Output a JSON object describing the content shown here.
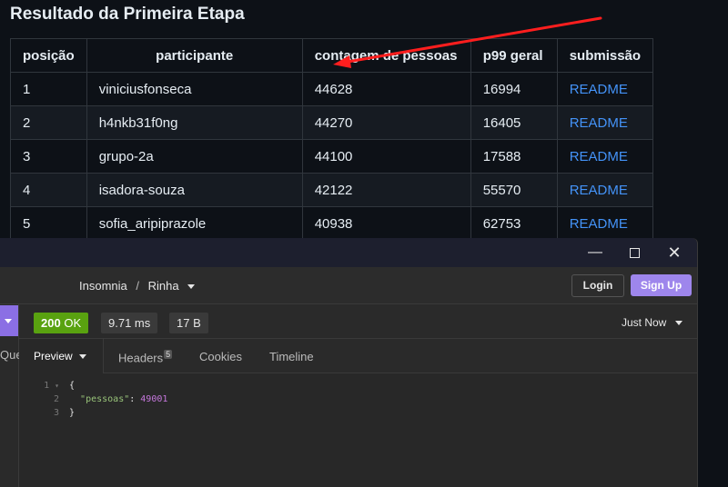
{
  "page": {
    "title": "Resultado da Primeira Etapa"
  },
  "results_table": {
    "headers": [
      "posição",
      "participante",
      "contagem de pessoas",
      "p99 geral",
      "submissão"
    ],
    "rows": [
      {
        "pos": "1",
        "participant": "viniciusfonseca",
        "count": "44628",
        "p99": "16994",
        "submission": "README"
      },
      {
        "pos": "2",
        "participant": "h4nkb31f0ng",
        "count": "44270",
        "p99": "16405",
        "submission": "README"
      },
      {
        "pos": "3",
        "participant": "grupo-2a",
        "count": "44100",
        "p99": "17588",
        "submission": "README"
      },
      {
        "pos": "4",
        "participant": "isadora-souza",
        "count": "42122",
        "p99": "55570",
        "submission": "README"
      },
      {
        "pos": "5",
        "participant": "sofia_aripiprazole",
        "count": "40938",
        "p99": "62753",
        "submission": "README"
      }
    ]
  },
  "annotation": {
    "arrow_color": "#ff1e1e"
  },
  "insomnia": {
    "window_controls": {
      "minimize": "—",
      "maximize": "",
      "close": "✕"
    },
    "breadcrumb": {
      "app": "Insomnia",
      "separator": "/",
      "collection": "Rinha"
    },
    "login_label": "Login",
    "signup_label": "Sign Up",
    "left_tab_label": "Que",
    "status": {
      "code": "200",
      "text": "OK",
      "time": "9.71 ms",
      "size": "17 B",
      "when": "Just Now"
    },
    "tabs": {
      "preview": "Preview",
      "headers": "Headers",
      "headers_count": "5",
      "cookies": "Cookies",
      "timeline": "Timeline"
    },
    "response_lines": [
      {
        "n": "1",
        "text": "{"
      },
      {
        "n": "2",
        "key": "\"pessoas\"",
        "colon": ": ",
        "value": "49001"
      },
      {
        "n": "3",
        "text": "}"
      }
    ],
    "colors": {
      "accent": "#9e86ec",
      "ok": "#59a210"
    }
  }
}
